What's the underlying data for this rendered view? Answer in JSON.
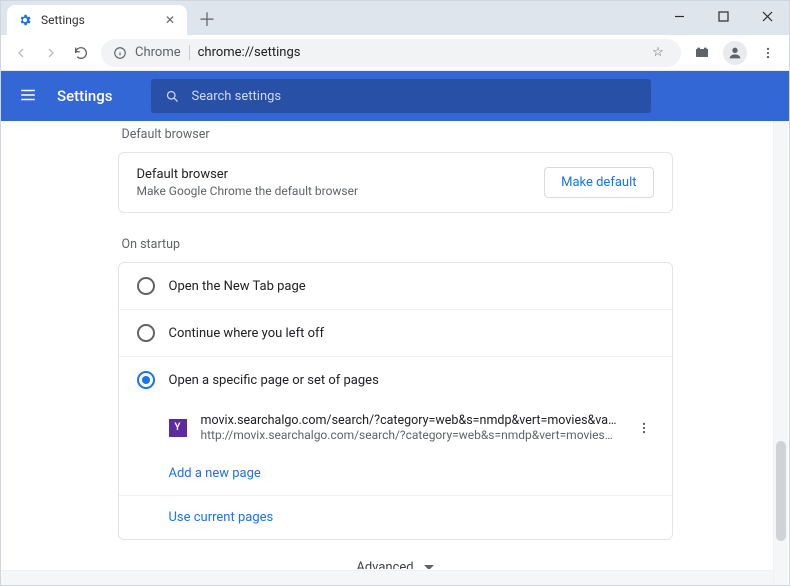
{
  "window": {
    "tab_title": "Settings",
    "address_scheme": "Chrome",
    "address_url": "chrome://settings"
  },
  "header": {
    "title": "Settings",
    "search_placeholder": "Search settings"
  },
  "default_browser": {
    "section_title": "Default browser",
    "row_title": "Default browser",
    "row_sub": "Make Google Chrome the default browser",
    "button": "Make default"
  },
  "startup": {
    "section_title": "On startup",
    "option_newtab": "Open the New Tab page",
    "option_continue": "Continue where you left off",
    "option_specific": "Open a specific page or set of pages",
    "page": {
      "title": "movix.searchalgo.com/search/?category=web&s=nmdp&vert=movies&var=plus&q=%s",
      "url": "http://movix.searchalgo.com/search/?category=web&s=nmdp&vert=movies&var=plu…"
    },
    "add_new_page": "Add a new page",
    "use_current_pages": "Use current pages"
  },
  "advanced": "Advanced"
}
